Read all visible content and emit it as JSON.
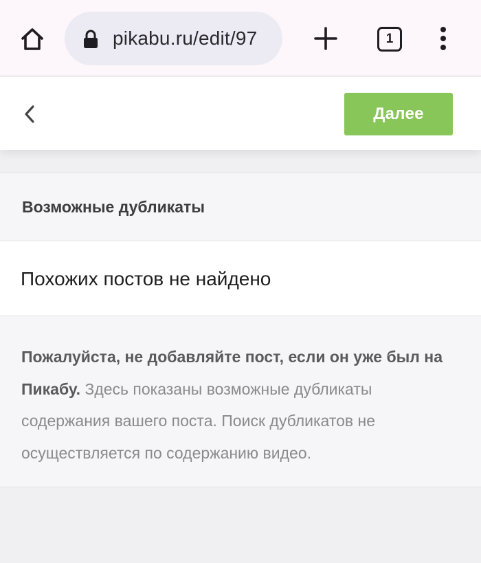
{
  "browser": {
    "url": "pikabu.ru/edit/97",
    "tab_count": "1"
  },
  "header": {
    "next_label": "Далее"
  },
  "duplicates": {
    "title": "Возможные дубликаты",
    "empty_message": "Похожих постов не найдено",
    "note_bold": "Пожалуйста, не добавляйте пост, если он уже был на Пикабу.",
    "note_regular": " Здесь показаны возможные дубликаты содержания вашего поста. Поиск дубликатов не осуществляется по содержанию видео."
  },
  "colors": {
    "accent_green": "#88c65a",
    "browser_bar": "#fdf7fb",
    "url_pill": "#ecebf3"
  },
  "icons": [
    "home-icon",
    "lock-icon",
    "plus-icon",
    "tabs-icon",
    "more-vert-icon",
    "chevron-left-icon"
  ]
}
